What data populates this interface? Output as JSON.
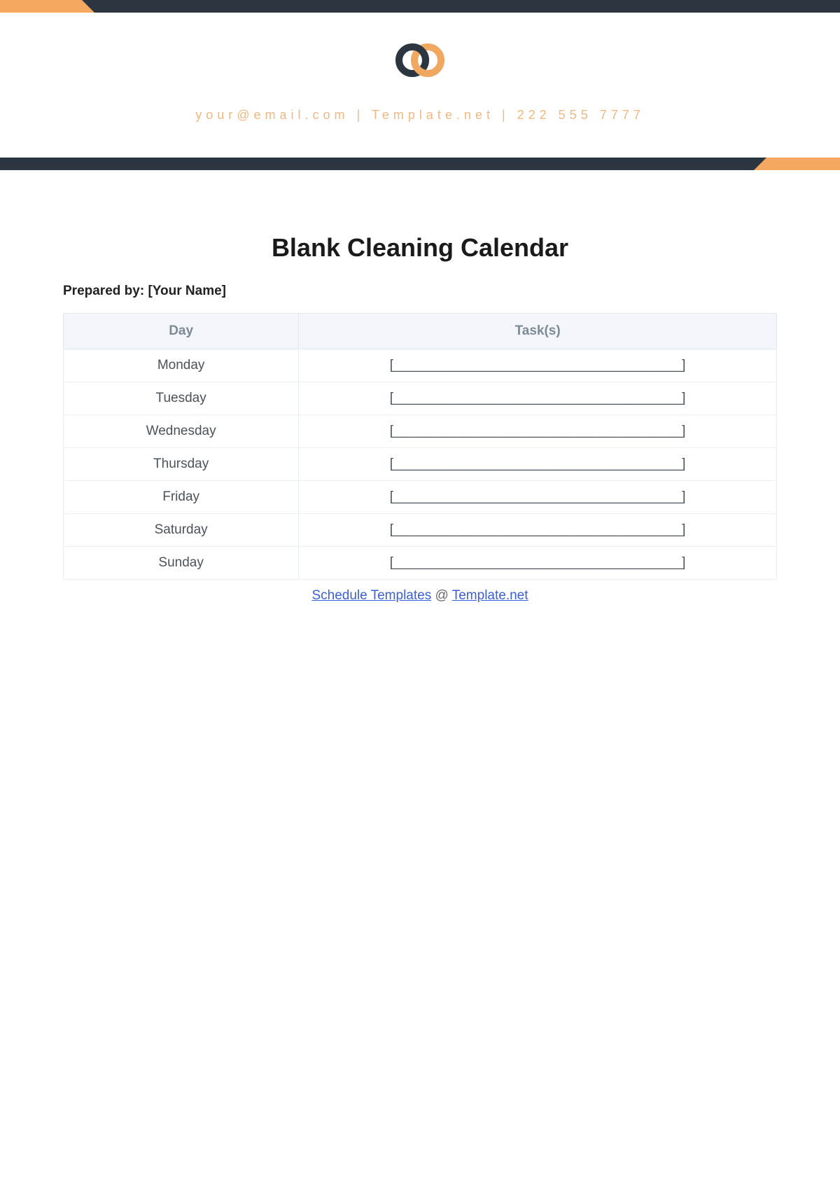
{
  "header": {
    "contact": "your@email.com | Template.net | 222 555 7777"
  },
  "document": {
    "title": "Blank Cleaning Calendar",
    "prepared_by_label": "Prepared by:",
    "prepared_by_value": "[Your Name]"
  },
  "table": {
    "headers": {
      "day": "Day",
      "tasks": "Task(s)"
    },
    "rows": [
      {
        "day": "Monday",
        "task": "[_______________________________________]"
      },
      {
        "day": "Tuesday",
        "task": "[_______________________________________]"
      },
      {
        "day": "Wednesday",
        "task": "[_______________________________________]"
      },
      {
        "day": "Thursday",
        "task": "[_______________________________________]"
      },
      {
        "day": "Friday",
        "task": "[_______________________________________]"
      },
      {
        "day": "Saturday",
        "task": "[_______________________________________]"
      },
      {
        "day": "Sunday",
        "task": "[_______________________________________]"
      }
    ]
  },
  "footer": {
    "link1": "Schedule Templates",
    "at": " @ ",
    "link2": "Template.net"
  }
}
